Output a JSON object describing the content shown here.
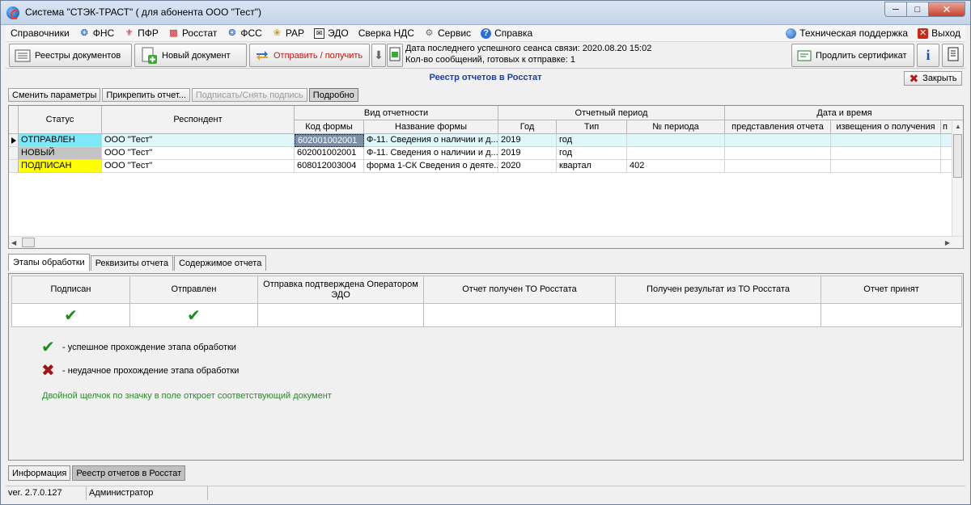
{
  "window": {
    "title": "Система \"СТЭК-ТРАСТ\" ( для абонента ООО \"Тест\")"
  },
  "menu": {
    "items": [
      {
        "label": "Справочники",
        "icon": ""
      },
      {
        "label": "ФНС",
        "icon": "fns-icon"
      },
      {
        "label": "ПФР",
        "icon": "pfr-icon"
      },
      {
        "label": "Росстат",
        "icon": "rosstat-icon"
      },
      {
        "label": "ФСС",
        "icon": "fss-icon"
      },
      {
        "label": "РАР",
        "icon": "rar-icon"
      },
      {
        "label": "ЭДО",
        "icon": "edo-icon"
      },
      {
        "label": "Сверка НДС",
        "icon": ""
      },
      {
        "label": "Сервис",
        "icon": "gear-icon"
      },
      {
        "label": "Справка",
        "icon": "help-icon"
      }
    ],
    "support": "Техническая поддержка",
    "exit": "Выход"
  },
  "toolbar": {
    "registries": "Реестры документов",
    "new_doc": "Новый документ",
    "send_receive": "Отправить / получить",
    "last_session": "Дата последнего успешного сеанса связи: 2020.08.20 15:02",
    "ready_count": "Кол-во сообщений, готовых к отправке: 1",
    "renew_cert": "Продлить сертификат"
  },
  "header": {
    "title": "Реестр отчетов в Росстат",
    "close": "Закрыть"
  },
  "subtoolbar": {
    "change_params": "Сменить параметры",
    "attach": "Прикрепить отчет...",
    "sign": "Подписать/Снять подпись",
    "details": "Подробно"
  },
  "grid": {
    "headers": {
      "status": "Статус",
      "respondent": "Респондент",
      "report_type": "Вид отчетности",
      "form_code": "Код формы",
      "form_name": "Название формы",
      "period": "Отчетный период",
      "year": "Год",
      "type": "Тип",
      "period_no": "№ периода",
      "datetime": "Дата и время",
      "submitted": "представления отчета",
      "notice": "извещения о получения",
      "extra": "п"
    },
    "rows": [
      {
        "status": "ОТПРАВЛЕН",
        "status_color": "#7fe8f7",
        "respondent": "ООО \"Тест\"",
        "code": "602001002001",
        "name": "Ф-11. Сведения о наличии и д...",
        "year": "2019",
        "type": "год",
        "period_no": ""
      },
      {
        "status": "НОВЫЙ",
        "status_color": "#c4c4c4",
        "respondent": "ООО \"Тест\"",
        "code": "602001002001",
        "name": "Ф-11. Сведения о наличии и д...",
        "year": "2019",
        "type": "год",
        "period_no": ""
      },
      {
        "status": "ПОДПИСАН",
        "status_color": "#ffff00",
        "respondent": "ООО \"Тест\"",
        "code": "608012003004",
        "name": "форма 1-СК Сведения о деяте...",
        "year": "2020",
        "type": "квартал",
        "period_no": "402"
      }
    ]
  },
  "tabs": [
    "Этапы обработки",
    "Реквизиты отчета",
    "Содержимое отчета"
  ],
  "stages": {
    "headers": [
      "Подписан",
      "Отправлен",
      "Отправка подтверждена Оператором ЭДО",
      "Отчет получен ТО Росстата",
      "Получен результат из ТО Росстата",
      "Отчет принят"
    ],
    "success_legend": "-  успешное прохождение этапа обработки",
    "fail_legend": "-  неудачное прохождение этапа обработки",
    "hint": "Двойной щелчок по значку в поле откроет соответствующий документ"
  },
  "bottom_tabs": [
    "Информация",
    "Реестр отчетов в Росстат"
  ],
  "status": {
    "version": "ver. 2.7.0.127",
    "user": "Администратор"
  }
}
